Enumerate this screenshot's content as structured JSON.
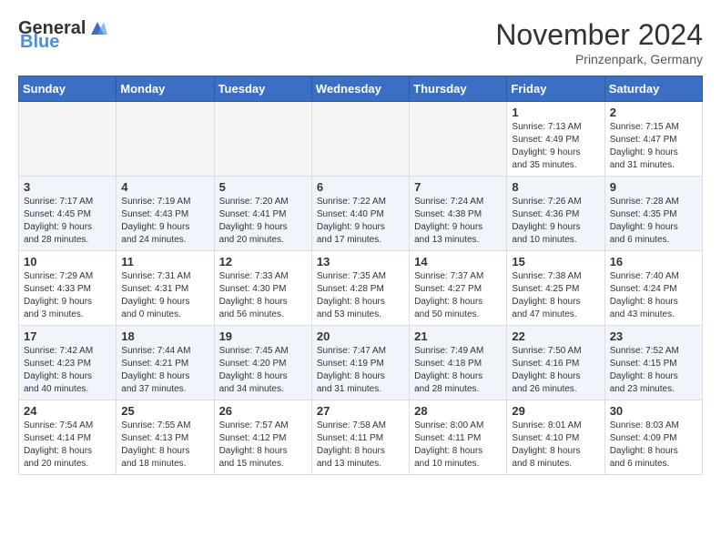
{
  "header": {
    "logo_general": "General",
    "logo_blue": "Blue",
    "month_title": "November 2024",
    "location": "Prinzenpark, Germany"
  },
  "days_of_week": [
    "Sunday",
    "Monday",
    "Tuesday",
    "Wednesday",
    "Thursday",
    "Friday",
    "Saturday"
  ],
  "weeks": [
    {
      "days": [
        {
          "date": "",
          "info": ""
        },
        {
          "date": "",
          "info": ""
        },
        {
          "date": "",
          "info": ""
        },
        {
          "date": "",
          "info": ""
        },
        {
          "date": "",
          "info": ""
        },
        {
          "date": "1",
          "info": "Sunrise: 7:13 AM\nSunset: 4:49 PM\nDaylight: 9 hours\nand 35 minutes."
        },
        {
          "date": "2",
          "info": "Sunrise: 7:15 AM\nSunset: 4:47 PM\nDaylight: 9 hours\nand 31 minutes."
        }
      ]
    },
    {
      "days": [
        {
          "date": "3",
          "info": "Sunrise: 7:17 AM\nSunset: 4:45 PM\nDaylight: 9 hours\nand 28 minutes."
        },
        {
          "date": "4",
          "info": "Sunrise: 7:19 AM\nSunset: 4:43 PM\nDaylight: 9 hours\nand 24 minutes."
        },
        {
          "date": "5",
          "info": "Sunrise: 7:20 AM\nSunset: 4:41 PM\nDaylight: 9 hours\nand 20 minutes."
        },
        {
          "date": "6",
          "info": "Sunrise: 7:22 AM\nSunset: 4:40 PM\nDaylight: 9 hours\nand 17 minutes."
        },
        {
          "date": "7",
          "info": "Sunrise: 7:24 AM\nSunset: 4:38 PM\nDaylight: 9 hours\nand 13 minutes."
        },
        {
          "date": "8",
          "info": "Sunrise: 7:26 AM\nSunset: 4:36 PM\nDaylight: 9 hours\nand 10 minutes."
        },
        {
          "date": "9",
          "info": "Sunrise: 7:28 AM\nSunset: 4:35 PM\nDaylight: 9 hours\nand 6 minutes."
        }
      ]
    },
    {
      "days": [
        {
          "date": "10",
          "info": "Sunrise: 7:29 AM\nSunset: 4:33 PM\nDaylight: 9 hours\nand 3 minutes."
        },
        {
          "date": "11",
          "info": "Sunrise: 7:31 AM\nSunset: 4:31 PM\nDaylight: 9 hours\nand 0 minutes."
        },
        {
          "date": "12",
          "info": "Sunrise: 7:33 AM\nSunset: 4:30 PM\nDaylight: 8 hours\nand 56 minutes."
        },
        {
          "date": "13",
          "info": "Sunrise: 7:35 AM\nSunset: 4:28 PM\nDaylight: 8 hours\nand 53 minutes."
        },
        {
          "date": "14",
          "info": "Sunrise: 7:37 AM\nSunset: 4:27 PM\nDaylight: 8 hours\nand 50 minutes."
        },
        {
          "date": "15",
          "info": "Sunrise: 7:38 AM\nSunset: 4:25 PM\nDaylight: 8 hours\nand 47 minutes."
        },
        {
          "date": "16",
          "info": "Sunrise: 7:40 AM\nSunset: 4:24 PM\nDaylight: 8 hours\nand 43 minutes."
        }
      ]
    },
    {
      "days": [
        {
          "date": "17",
          "info": "Sunrise: 7:42 AM\nSunset: 4:23 PM\nDaylight: 8 hours\nand 40 minutes."
        },
        {
          "date": "18",
          "info": "Sunrise: 7:44 AM\nSunset: 4:21 PM\nDaylight: 8 hours\nand 37 minutes."
        },
        {
          "date": "19",
          "info": "Sunrise: 7:45 AM\nSunset: 4:20 PM\nDaylight: 8 hours\nand 34 minutes."
        },
        {
          "date": "20",
          "info": "Sunrise: 7:47 AM\nSunset: 4:19 PM\nDaylight: 8 hours\nand 31 minutes."
        },
        {
          "date": "21",
          "info": "Sunrise: 7:49 AM\nSunset: 4:18 PM\nDaylight: 8 hours\nand 28 minutes."
        },
        {
          "date": "22",
          "info": "Sunrise: 7:50 AM\nSunset: 4:16 PM\nDaylight: 8 hours\nand 26 minutes."
        },
        {
          "date": "23",
          "info": "Sunrise: 7:52 AM\nSunset: 4:15 PM\nDaylight: 8 hours\nand 23 minutes."
        }
      ]
    },
    {
      "days": [
        {
          "date": "24",
          "info": "Sunrise: 7:54 AM\nSunset: 4:14 PM\nDaylight: 8 hours\nand 20 minutes."
        },
        {
          "date": "25",
          "info": "Sunrise: 7:55 AM\nSunset: 4:13 PM\nDaylight: 8 hours\nand 18 minutes."
        },
        {
          "date": "26",
          "info": "Sunrise: 7:57 AM\nSunset: 4:12 PM\nDaylight: 8 hours\nand 15 minutes."
        },
        {
          "date": "27",
          "info": "Sunrise: 7:58 AM\nSunset: 4:11 PM\nDaylight: 8 hours\nand 13 minutes."
        },
        {
          "date": "28",
          "info": "Sunrise: 8:00 AM\nSunset: 4:11 PM\nDaylight: 8 hours\nand 10 minutes."
        },
        {
          "date": "29",
          "info": "Sunrise: 8:01 AM\nSunset: 4:10 PM\nDaylight: 8 hours\nand 8 minutes."
        },
        {
          "date": "30",
          "info": "Sunrise: 8:03 AM\nSunset: 4:09 PM\nDaylight: 8 hours\nand 6 minutes."
        }
      ]
    }
  ]
}
